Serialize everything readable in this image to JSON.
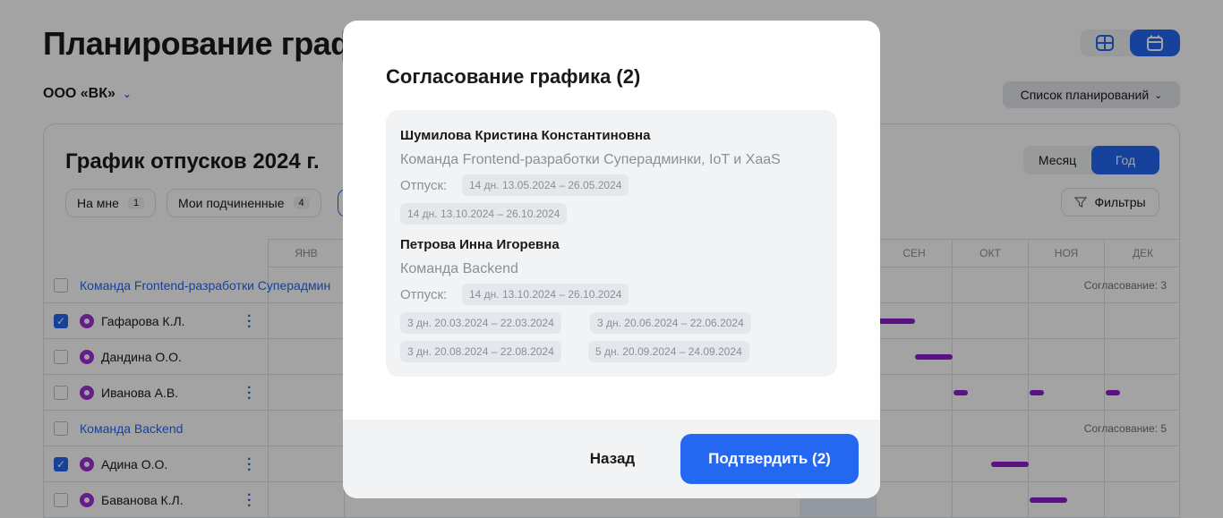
{
  "page": {
    "title": "Планирование графика",
    "org": "ООО «ВК»",
    "plan_list_label": "Список планирований",
    "calendar_title": "График отпусков 2024 г.",
    "period_tabs": [
      "Месяц",
      "Год"
    ],
    "chips": [
      {
        "label": "На мне",
        "count": "1"
      },
      {
        "label": "Мои подчиненные",
        "count": "4"
      }
    ],
    "filters_label": "Фильтры",
    "months_visible": [
      "ЯНВ",
      "СЕН",
      "ОКТ",
      "НОЯ",
      "ДЕК"
    ],
    "groups": [
      {
        "label": "Команда Frontend-разработки Суперадмин",
        "approval": "Согласование: 3"
      },
      {
        "label": "Команда Backend",
        "approval": "Согласование: 5"
      }
    ],
    "people": [
      {
        "name": "Гафарова К.Л.",
        "checked": true
      },
      {
        "name": "Дандина О.О.",
        "checked": false
      },
      {
        "name": "Иванова А.В.",
        "checked": false
      },
      {
        "name": "Адина О.О.",
        "checked": true
      },
      {
        "name": "Баванова К.Л.",
        "checked": false
      }
    ],
    "colors": {
      "accent": "#2468f2",
      "vacation_bar": "#8b1fd0"
    }
  },
  "modal": {
    "title": "Согласование графика (2)",
    "vacation_label": "Отпуск:",
    "employees": [
      {
        "name": "Шумилова Кристина Константиновна",
        "team": "Команда Frontend-разработки Суперадминки, IoT и XaaS",
        "vacations": [
          "14 дн. 13.05.2024 – 26.05.2024",
          "14 дн. 13.10.2024 – 26.10.2024"
        ]
      },
      {
        "name": "Петрова Инна Игоревна",
        "team": "Команда Backend",
        "vacations": [
          "14 дн. 13.10.2024 – 26.10.2024",
          "3 дн. 20.03.2024 – 22.03.2024",
          "3 дн. 20.06.2024 – 22.06.2024",
          "3 дн. 20.08.2024 – 22.08.2024",
          "5 дн. 20.09.2024 – 24.09.2024"
        ]
      }
    ],
    "back_label": "Назад",
    "confirm_label": "Подтвердить (2)"
  }
}
